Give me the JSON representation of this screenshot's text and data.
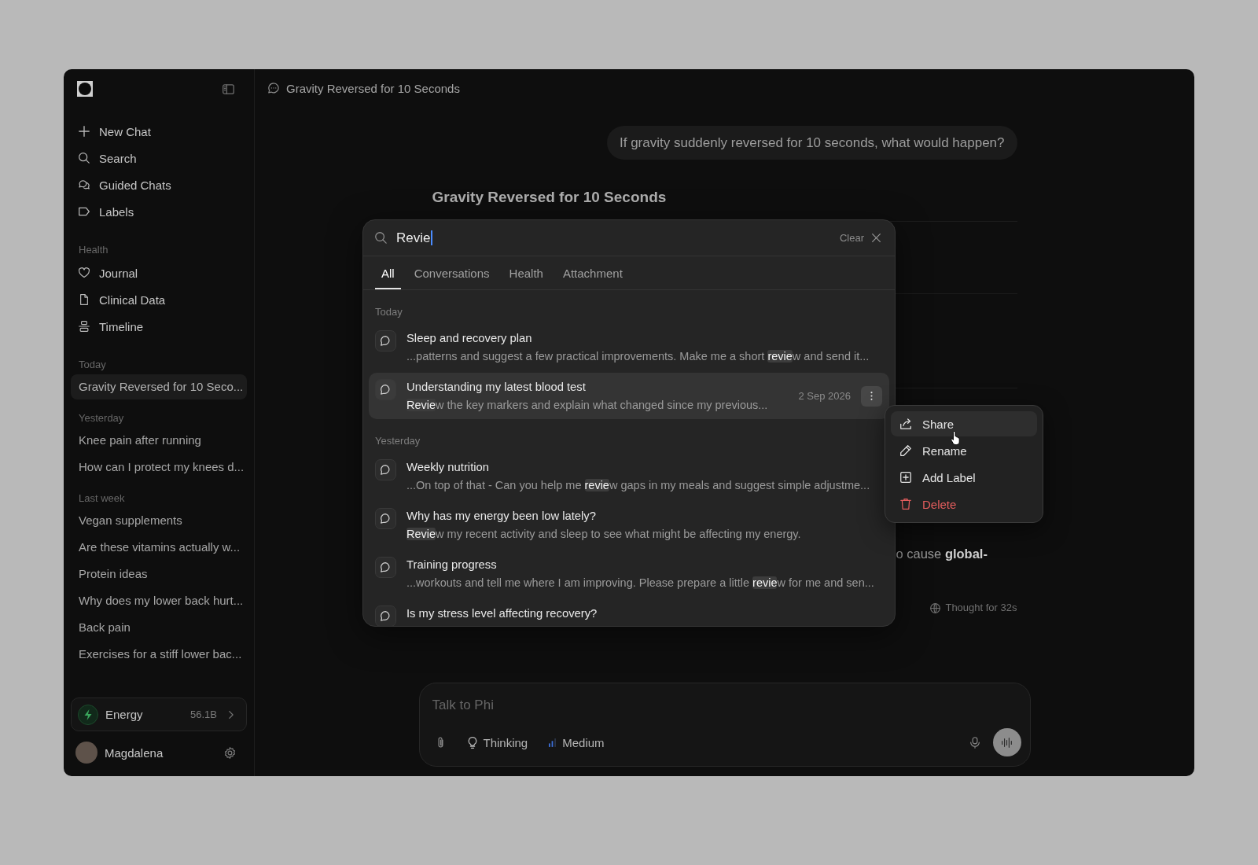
{
  "sidebar": {
    "nav": [
      {
        "label": "New Chat"
      },
      {
        "label": "Search"
      },
      {
        "label": "Guided Chats"
      },
      {
        "label": "Labels"
      }
    ],
    "health": {
      "label": "Health",
      "items": [
        {
          "label": "Journal"
        },
        {
          "label": "Clinical Data"
        },
        {
          "label": "Timeline"
        }
      ]
    },
    "history": [
      {
        "label": "Today",
        "chats": [
          {
            "title": "Gravity Reversed for 10 Seco...",
            "selected": true
          }
        ]
      },
      {
        "label": "Yesterday",
        "chats": [
          {
            "title": "Knee pain after running",
            "selected": false
          },
          {
            "title": "How can I protect my knees d...",
            "selected": false
          }
        ]
      },
      {
        "label": "Last week",
        "chats": [
          {
            "title": "Vegan supplements",
            "selected": false
          },
          {
            "title": "Are these vitamins actually w...",
            "selected": false
          },
          {
            "title": "Protein ideas",
            "selected": false
          },
          {
            "title": "Why does my lower back hurt...",
            "selected": false
          },
          {
            "title": "Back pain",
            "selected": false
          },
          {
            "title": "Exercises for a stiff lower bac...",
            "selected": false
          }
        ]
      }
    ],
    "energy": {
      "label": "Energy",
      "value": "56.1B"
    },
    "user": {
      "name": "Magdalena"
    }
  },
  "header": {
    "title": "Gravity Reversed for 10 Seconds"
  },
  "conversation": {
    "user_message": "If gravity suddenly reversed for 10 seconds, what would happen?",
    "answer_title": "Gravity Reversed for 10 Seconds",
    "answer_fragment": "o cause **global-**",
    "thought": "Thought for 32s"
  },
  "composer": {
    "placeholder": "Talk to Phi",
    "thinking_label": "Thinking",
    "effort_label": "Medium"
  },
  "search": {
    "query": "Revie",
    "focused": true,
    "clear_label": "Clear",
    "tabs": [
      {
        "label": "All",
        "selected": true
      },
      {
        "label": "Conversations",
        "selected": false
      },
      {
        "label": "Health",
        "selected": false
      },
      {
        "label": "Attachment",
        "selected": false
      }
    ],
    "groups": [
      {
        "label": "Today",
        "results": [
          {
            "title": "Sleep and recovery plan",
            "hovered": false,
            "snippet": [
              {
                "text": "...patterns and suggest a few practical improvements. Make me a short ",
                "match": false
              },
              {
                "text": "revie",
                "match": true
              },
              {
                "text": "w and send it...",
                "match": false
              }
            ]
          },
          {
            "title": "Understanding my latest blood test",
            "hovered": true,
            "date": "2 Sep 2026",
            "snippet": [
              {
                "text": "Revie",
                "match": true
              },
              {
                "text": "w the key markers and explain what changed since my previous...",
                "match": false
              }
            ]
          }
        ]
      },
      {
        "label": "Yesterday",
        "results": [
          {
            "title": "Weekly nutrition",
            "hovered": false,
            "snippet": [
              {
                "text": "...On top of that - Can you help me ",
                "match": false
              },
              {
                "text": "revie",
                "match": true
              },
              {
                "text": "w gaps in my meals and suggest simple adjustme...",
                "match": false
              }
            ]
          },
          {
            "title": "Why has my energy been low lately?",
            "hovered": false,
            "snippet": [
              {
                "text": "Revie",
                "match": true
              },
              {
                "text": "w my recent activity and sleep to see what might be affecting my energy.",
                "match": false
              }
            ]
          },
          {
            "title": "Training progress",
            "hovered": false,
            "snippet": [
              {
                "text": "...workouts and tell me where I am improving. Please prepare a little ",
                "match": false
              },
              {
                "text": "revie",
                "match": true
              },
              {
                "text": "w for me and sen...",
                "match": false
              }
            ]
          },
          {
            "title": "Is my stress level affecting recovery?",
            "hovered": false
          }
        ]
      }
    ]
  },
  "context_menu": {
    "items": [
      {
        "label": "Share",
        "kind": "normal",
        "highlighted": true
      },
      {
        "label": "Rename",
        "kind": "normal",
        "highlighted": false
      },
      {
        "label": "Add Label",
        "kind": "normal",
        "highlighted": false
      },
      {
        "label": "Delete",
        "kind": "danger",
        "highlighted": false
      }
    ]
  }
}
